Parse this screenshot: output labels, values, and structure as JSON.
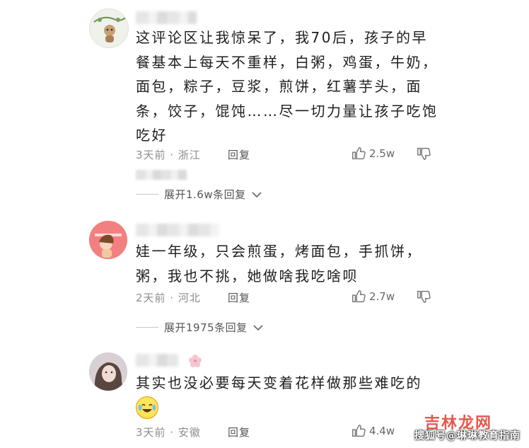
{
  "comments": [
    {
      "text": "这评论区让我惊呆了，我70后，孩子的早餐基本上每天不重样，白粥，鸡蛋，牛奶，面包，粽子，豆浆，煎饼，红薯芋头，面条，饺子，馄饨……尽一切力量让孩子吃饱吃好",
      "meta": "3天前 · 浙江",
      "reply_label": "回复",
      "likes": "2.5w",
      "expand": "展开1.6w条回复"
    },
    {
      "text": "娃一年级，只会煎蛋，烤面包，手抓饼，粥，我也不挑，她做啥我吃啥呗",
      "meta": "2天前 · 河北",
      "reply_label": "回复",
      "likes": "2.7w",
      "expand": "展开1975条回复"
    },
    {
      "text": "其实也没必要每天变着花样做那些难吃的",
      "meta": "3天前 · 安徽",
      "reply_label": "回复",
      "likes": "4.4w"
    }
  ],
  "watermark": "搜狐号@琳琳教育指南",
  "watermark_brand": "吉林龙网",
  "colors": {
    "meta": "#8d8d8d",
    "text": "#1e1e1e"
  }
}
